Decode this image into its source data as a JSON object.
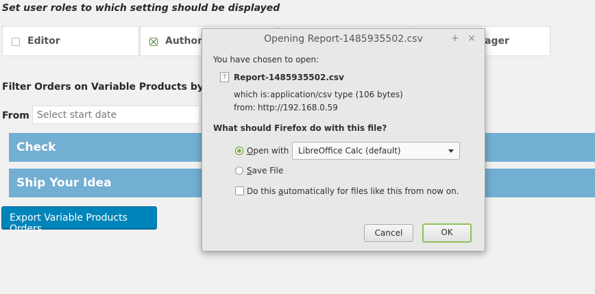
{
  "page": {
    "section_title": "Set user roles to which setting should be displayed",
    "roles": [
      {
        "label": "Editor",
        "checked": false
      },
      {
        "label": "Author",
        "checked": true
      },
      {
        "label": "ager",
        "checked": false
      }
    ],
    "filter_title": "Filter Orders on Variable Products by Date:",
    "from_label": "From :",
    "start_date_placeholder": "Select start date",
    "bars": [
      "Check",
      "Ship Your Idea"
    ],
    "export_button": "Export Variable Products Orders"
  },
  "dialog": {
    "title": "Opening Report-1485935502.csv",
    "maximize_icon": "+",
    "close_icon": "×",
    "intro": "You have chosen to open:",
    "file_icon": "?",
    "filename": "Report-1485935502.csv",
    "which_is_label": "which is:",
    "which_is_value": "application/csv type (106 bytes)",
    "from_label": "from:",
    "from_value": "http://192.168.0.59",
    "question": "What should Firefox do with this file?",
    "open_with_label": "Open with",
    "open_with_selected": true,
    "app_select_value": "LibreOffice Calc (default)",
    "save_file_label": "Save File",
    "auto_label": "Do this automatically for files like this from now on.",
    "auto_checked": false,
    "cancel_button": "Cancel",
    "ok_button": "OK"
  },
  "colors": {
    "bar_blue": "#72afd2",
    "button_blue": "#0085ba",
    "ok_border": "#8fbf5a"
  }
}
